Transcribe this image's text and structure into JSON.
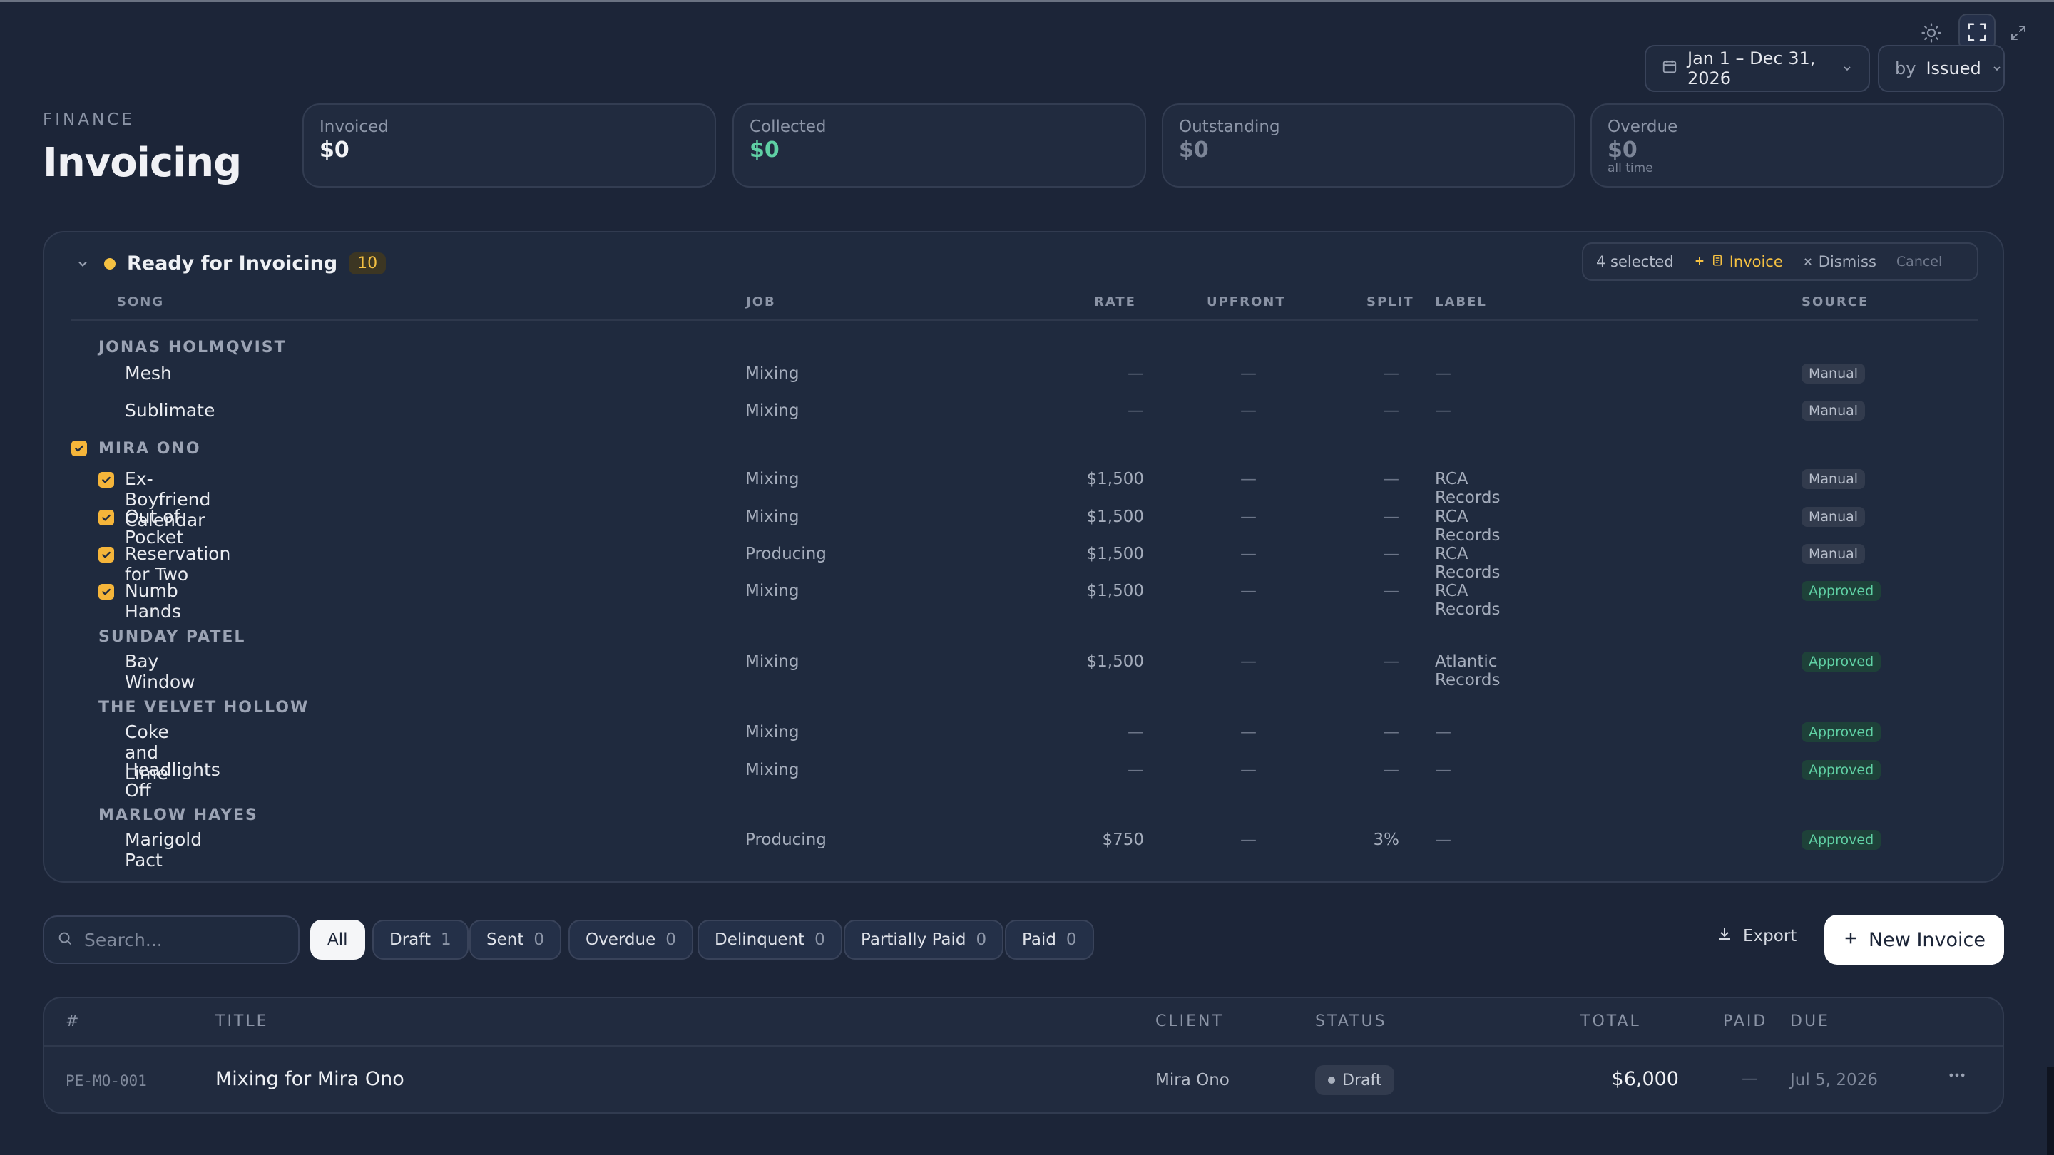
{
  "window": {
    "icons": [
      "sun-icon",
      "fullscreen-icon",
      "expand-icon"
    ]
  },
  "filters": {
    "date_range": "Jan 1 – Dec 31, 2026",
    "by_prefix": "by",
    "by_value": "Issued"
  },
  "header": {
    "eyebrow": "FINANCE",
    "title": "Invoicing"
  },
  "stats": [
    {
      "label": "Invoiced",
      "value": "$0",
      "color": "#f2f3f6"
    },
    {
      "label": "Collected",
      "value": "$0",
      "color": "#5fd0a4"
    },
    {
      "label": "Outstanding",
      "value": "$0",
      "color": "#7c8597"
    },
    {
      "label": "Overdue",
      "value": "$0",
      "sub": "all time",
      "color": "#7c8597"
    }
  ],
  "ready": {
    "title": "Ready for Invoicing",
    "count": "10",
    "bulk": {
      "selected": "4 selected",
      "invoice": "Invoice",
      "dismiss": "Dismiss",
      "cancel": "Cancel"
    },
    "columns": {
      "song": "SONG",
      "job": "JOB",
      "rate": "RATE",
      "upfront": "UPFRONT",
      "split": "SPLIT",
      "label": "LABEL",
      "source": "SOURCE"
    },
    "groups": [
      {
        "artist": "JONAS HOLMQVIST",
        "checked": false,
        "rows": [
          {
            "song": "Mesh",
            "job": "Mixing",
            "rate": "—",
            "upfront": "—",
            "split": "—",
            "label": "—",
            "source": "Manual",
            "checked": false
          },
          {
            "song": "Sublimate",
            "job": "Mixing",
            "rate": "—",
            "upfront": "—",
            "split": "—",
            "label": "—",
            "source": "Manual",
            "checked": false
          }
        ]
      },
      {
        "artist": "MIRA ONO",
        "checked": true,
        "rows": [
          {
            "song": "Ex-Boyfriend Calendar",
            "job": "Mixing",
            "rate": "$1,500",
            "upfront": "—",
            "split": "—",
            "label": "RCA Records",
            "source": "Manual",
            "checked": true
          },
          {
            "song": "Out of Pocket",
            "job": "Mixing",
            "rate": "$1,500",
            "upfront": "—",
            "split": "—",
            "label": "RCA Records",
            "source": "Manual",
            "checked": true
          },
          {
            "song": "Reservation for Two",
            "job": "Producing",
            "rate": "$1,500",
            "upfront": "—",
            "split": "—",
            "label": "RCA Records",
            "source": "Manual",
            "checked": true
          },
          {
            "song": "Numb Hands",
            "job": "Mixing",
            "rate": "$1,500",
            "upfront": "—",
            "split": "—",
            "label": "RCA Records",
            "source": "Approved",
            "checked": true
          }
        ]
      },
      {
        "artist": "SUNDAY PATEL",
        "checked": false,
        "rows": [
          {
            "song": "Bay Window",
            "job": "Mixing",
            "rate": "$1,500",
            "upfront": "—",
            "split": "—",
            "label": "Atlantic Records",
            "source": "Approved",
            "checked": false
          }
        ]
      },
      {
        "artist": "THE VELVET HOLLOW",
        "checked": false,
        "rows": [
          {
            "song": "Coke and Lime",
            "job": "Mixing",
            "rate": "—",
            "upfront": "—",
            "split": "—",
            "label": "—",
            "source": "Approved",
            "checked": false
          },
          {
            "song": "Headlights Off",
            "job": "Mixing",
            "rate": "—",
            "upfront": "—",
            "split": "—",
            "label": "—",
            "source": "Approved",
            "checked": false
          }
        ]
      },
      {
        "artist": "MARLOW HAYES",
        "checked": false,
        "rows": [
          {
            "song": "Marigold Pact",
            "job": "Producing",
            "rate": "$750",
            "upfront": "—",
            "split": "3%",
            "label": "—",
            "source": "Approved",
            "checked": false
          }
        ]
      }
    ]
  },
  "toolbar": {
    "search_placeholder": "Search...",
    "chips": [
      {
        "label": "All",
        "count": "",
        "active": true
      },
      {
        "label": "Draft",
        "count": "1",
        "active": false
      },
      {
        "label": "Sent",
        "count": "0",
        "active": false
      },
      {
        "label": "Overdue",
        "count": "0",
        "active": false
      },
      {
        "label": "Delinquent",
        "count": "0",
        "active": false
      },
      {
        "label": "Partially Paid",
        "count": "0",
        "active": false
      },
      {
        "label": "Paid",
        "count": "0",
        "active": false
      }
    ],
    "export": "Export",
    "new_invoice": "New Invoice"
  },
  "invoices": {
    "columns": {
      "num": "#",
      "title": "TITLE",
      "client": "CLIENT",
      "status": "STATUS",
      "total": "TOTAL",
      "paid": "PAID",
      "due": "DUE"
    },
    "rows": [
      {
        "num": "PE-MO-001",
        "title": "Mixing for Mira Ono",
        "client": "Mira Ono",
        "status": "Draft",
        "total": "$6,000",
        "paid": "—",
        "due": "Jul 5, 2026"
      }
    ]
  }
}
